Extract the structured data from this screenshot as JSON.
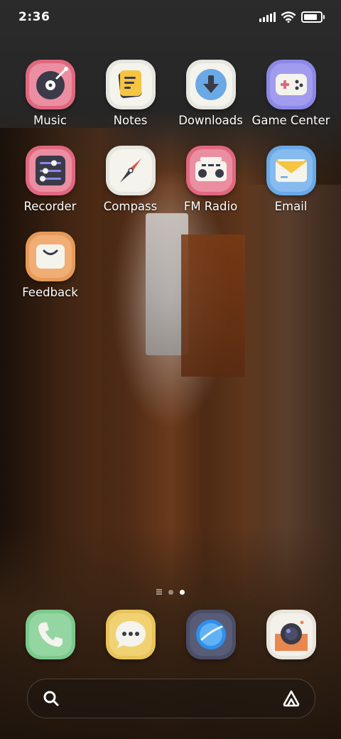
{
  "status_bar": {
    "time": "2:36",
    "battery_level": 1.0,
    "icons": [
      "signal-icon",
      "wifi-icon",
      "battery-icon"
    ]
  },
  "apps": [
    {
      "label": "Music",
      "icon": "music-disc-icon",
      "bg": "#e0687e",
      "inner": "#f0a3b3"
    },
    {
      "label": "Notes",
      "icon": "notes-icon",
      "bg": "#e6e6e0",
      "inner": "#f4f3ec"
    },
    {
      "label": "Downloads",
      "icon": "download-icon",
      "bg": "#e6e6e0",
      "inner": "#f4f3ec"
    },
    {
      "label": "Game Center",
      "icon": "gamepad-icon",
      "bg": "#8c88e6",
      "inner": "#a7a2f0"
    },
    {
      "label": "Recorder",
      "icon": "equalizer-icon",
      "bg": "#e0687e",
      "inner": "#f0a3b3"
    },
    {
      "label": "Compass",
      "icon": "compass-icon",
      "bg": "#e6e6e0",
      "inner": "#f4f3ec"
    },
    {
      "label": "FM Radio",
      "icon": "radio-icon",
      "bg": "#e0687e",
      "inner": "#f0a3b3"
    },
    {
      "label": "Email",
      "icon": "envelope-icon",
      "bg": "#6aa8e6",
      "inner": "#8cc0f0"
    },
    {
      "label": "Feedback",
      "icon": "shopping-bag-icon",
      "bg": "#e69a5a",
      "inner": "#f2b27a"
    }
  ],
  "page_indicator": {
    "pages": 2,
    "active": 2
  },
  "dock": [
    {
      "name": "phone",
      "icon": "phone-icon",
      "bg": "#7cc98c",
      "inner": "#9ddaa8"
    },
    {
      "name": "messages",
      "icon": "chat-bubble-icon",
      "bg": "#e8c45a",
      "inner": "#f2d67c"
    },
    {
      "name": "browser",
      "icon": "globe-icon",
      "bg": "#4a4e66",
      "inner": "#5a5e78"
    },
    {
      "name": "camera",
      "icon": "camera-icon",
      "bg": "#e8e4dc",
      "inner": "#f4f1ea"
    }
  ],
  "search_bar": {
    "left_icon": "search-icon",
    "right_icon": "assistant-icon"
  }
}
